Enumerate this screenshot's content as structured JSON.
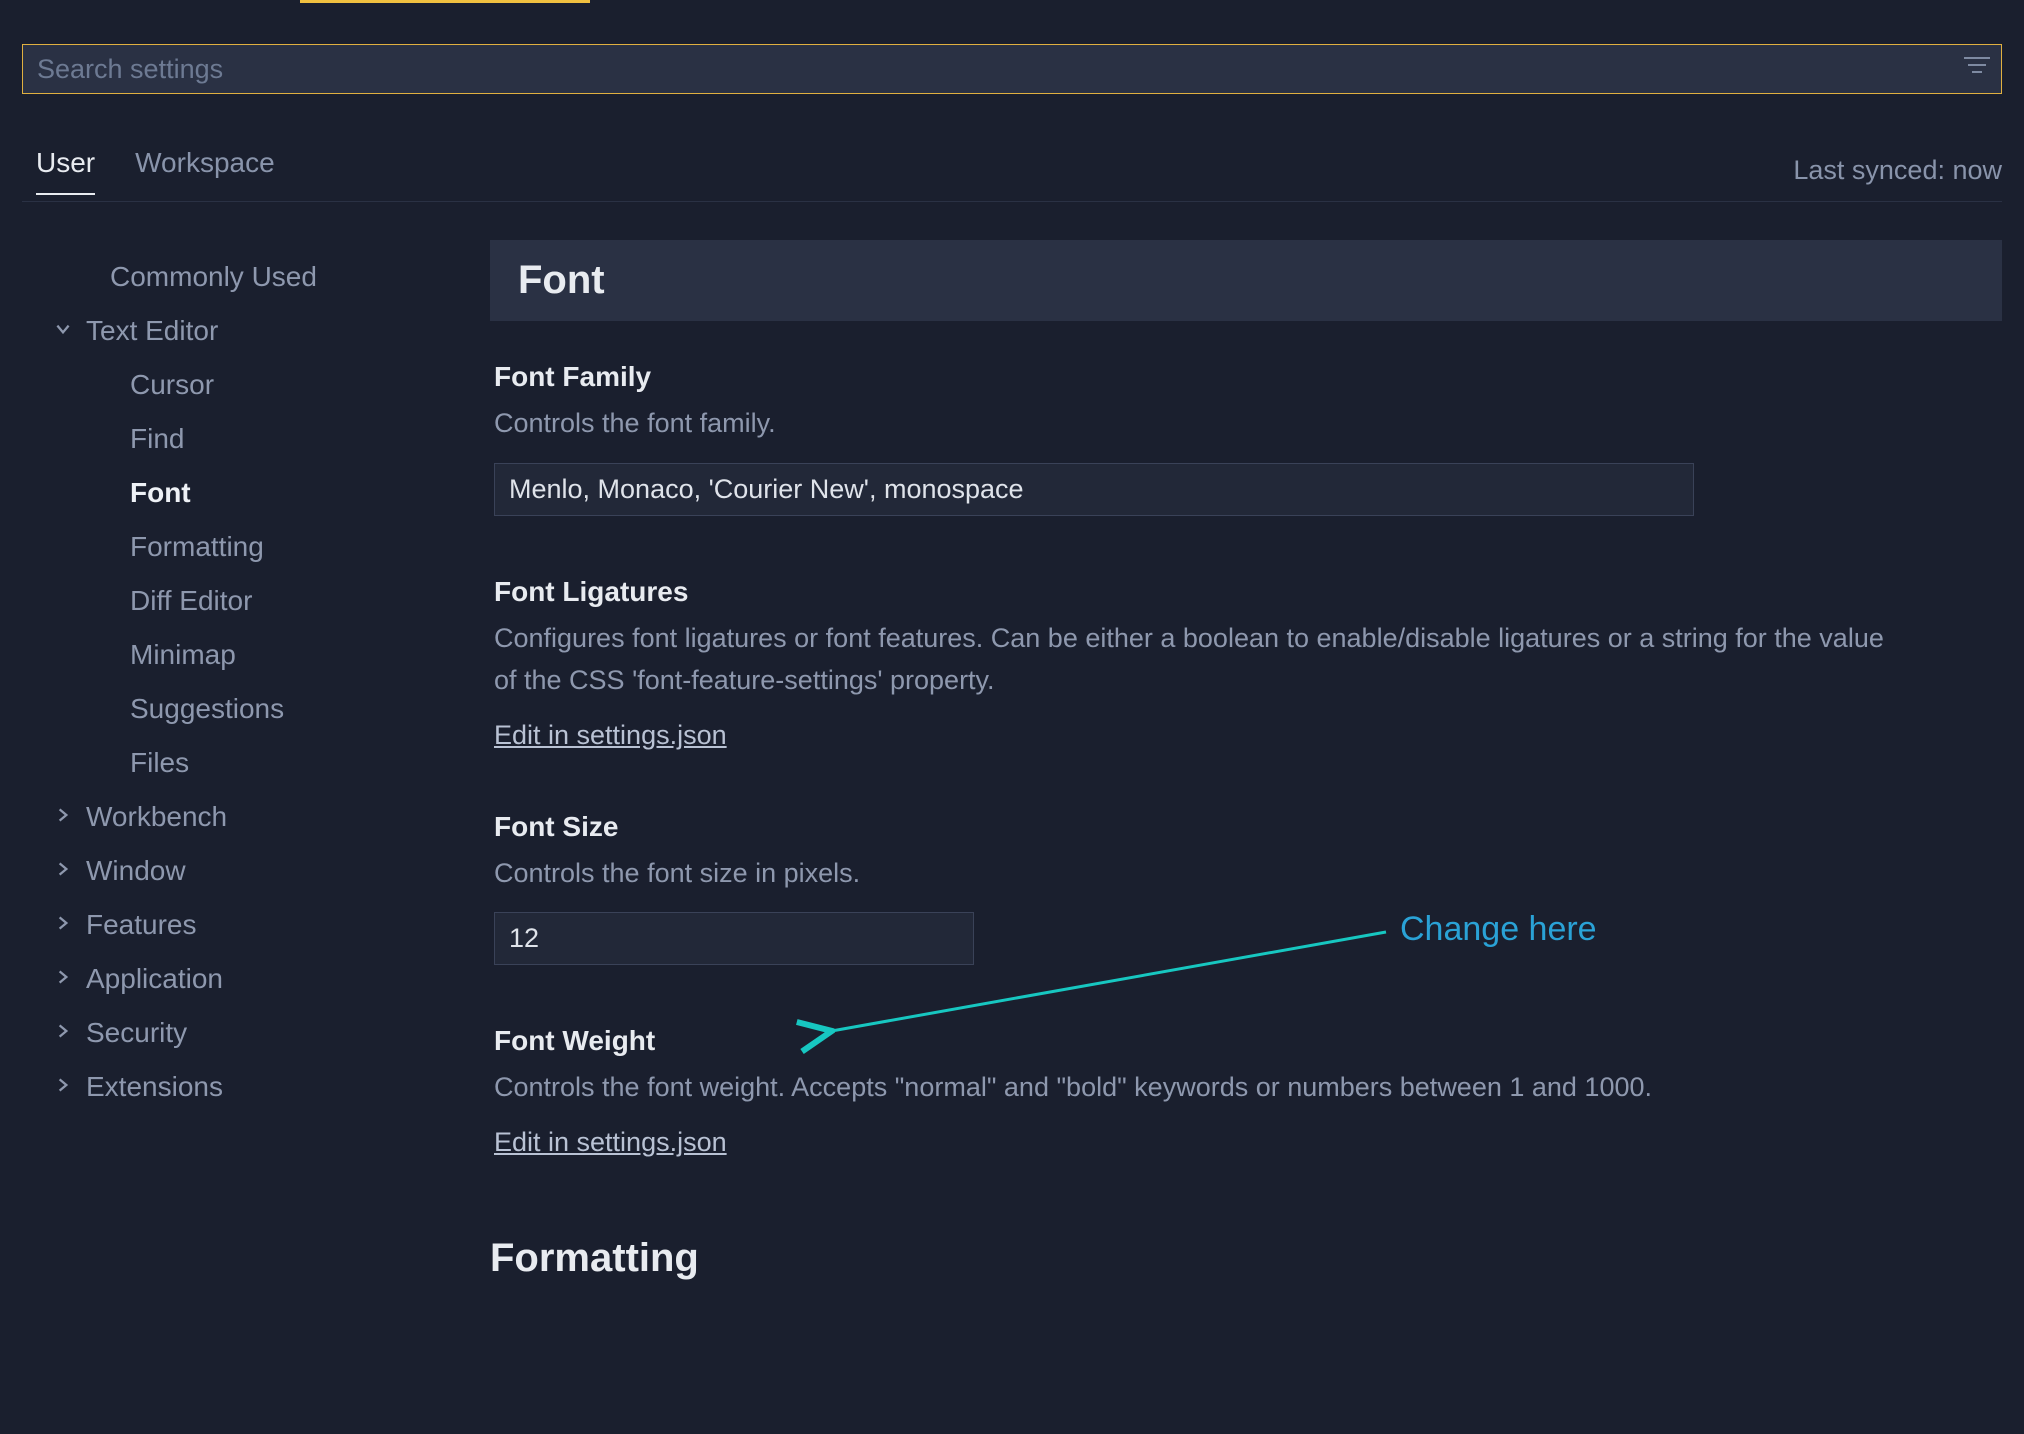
{
  "search": {
    "placeholder": "Search settings"
  },
  "tabs": {
    "user": "User",
    "workspace": "Workspace",
    "sync": "Last synced: now"
  },
  "sidebar": {
    "commonly_used": "Commonly Used",
    "text_editor": "Text Editor",
    "te_children": {
      "cursor": "Cursor",
      "find": "Find",
      "font": "Font",
      "formatting": "Formatting",
      "diff_editor": "Diff Editor",
      "minimap": "Minimap",
      "suggestions": "Suggestions",
      "files": "Files"
    },
    "workbench": "Workbench",
    "window": "Window",
    "features": "Features",
    "application": "Application",
    "security": "Security",
    "extensions": "Extensions"
  },
  "main": {
    "section_font": "Font",
    "section_formatting": "Formatting",
    "font_family": {
      "title": "Font Family",
      "desc": "Controls the font family.",
      "value": "Menlo, Monaco, 'Courier New', monospace"
    },
    "font_ligatures": {
      "title": "Font Ligatures",
      "desc": "Configures font ligatures or font features. Can be either a boolean to enable/disable ligatures or a string for the value of the CSS 'font-feature-settings' property.",
      "link": "Edit in settings.json"
    },
    "font_size": {
      "title": "Font Size",
      "desc": "Controls the font size in pixels.",
      "value": "12"
    },
    "font_weight": {
      "title": "Font Weight",
      "desc": "Controls the font weight. Accepts \"normal\" and \"bold\" keywords or numbers between 1 and 1000.",
      "link": "Edit in settings.json"
    }
  },
  "annotation": {
    "text": "Change here"
  }
}
